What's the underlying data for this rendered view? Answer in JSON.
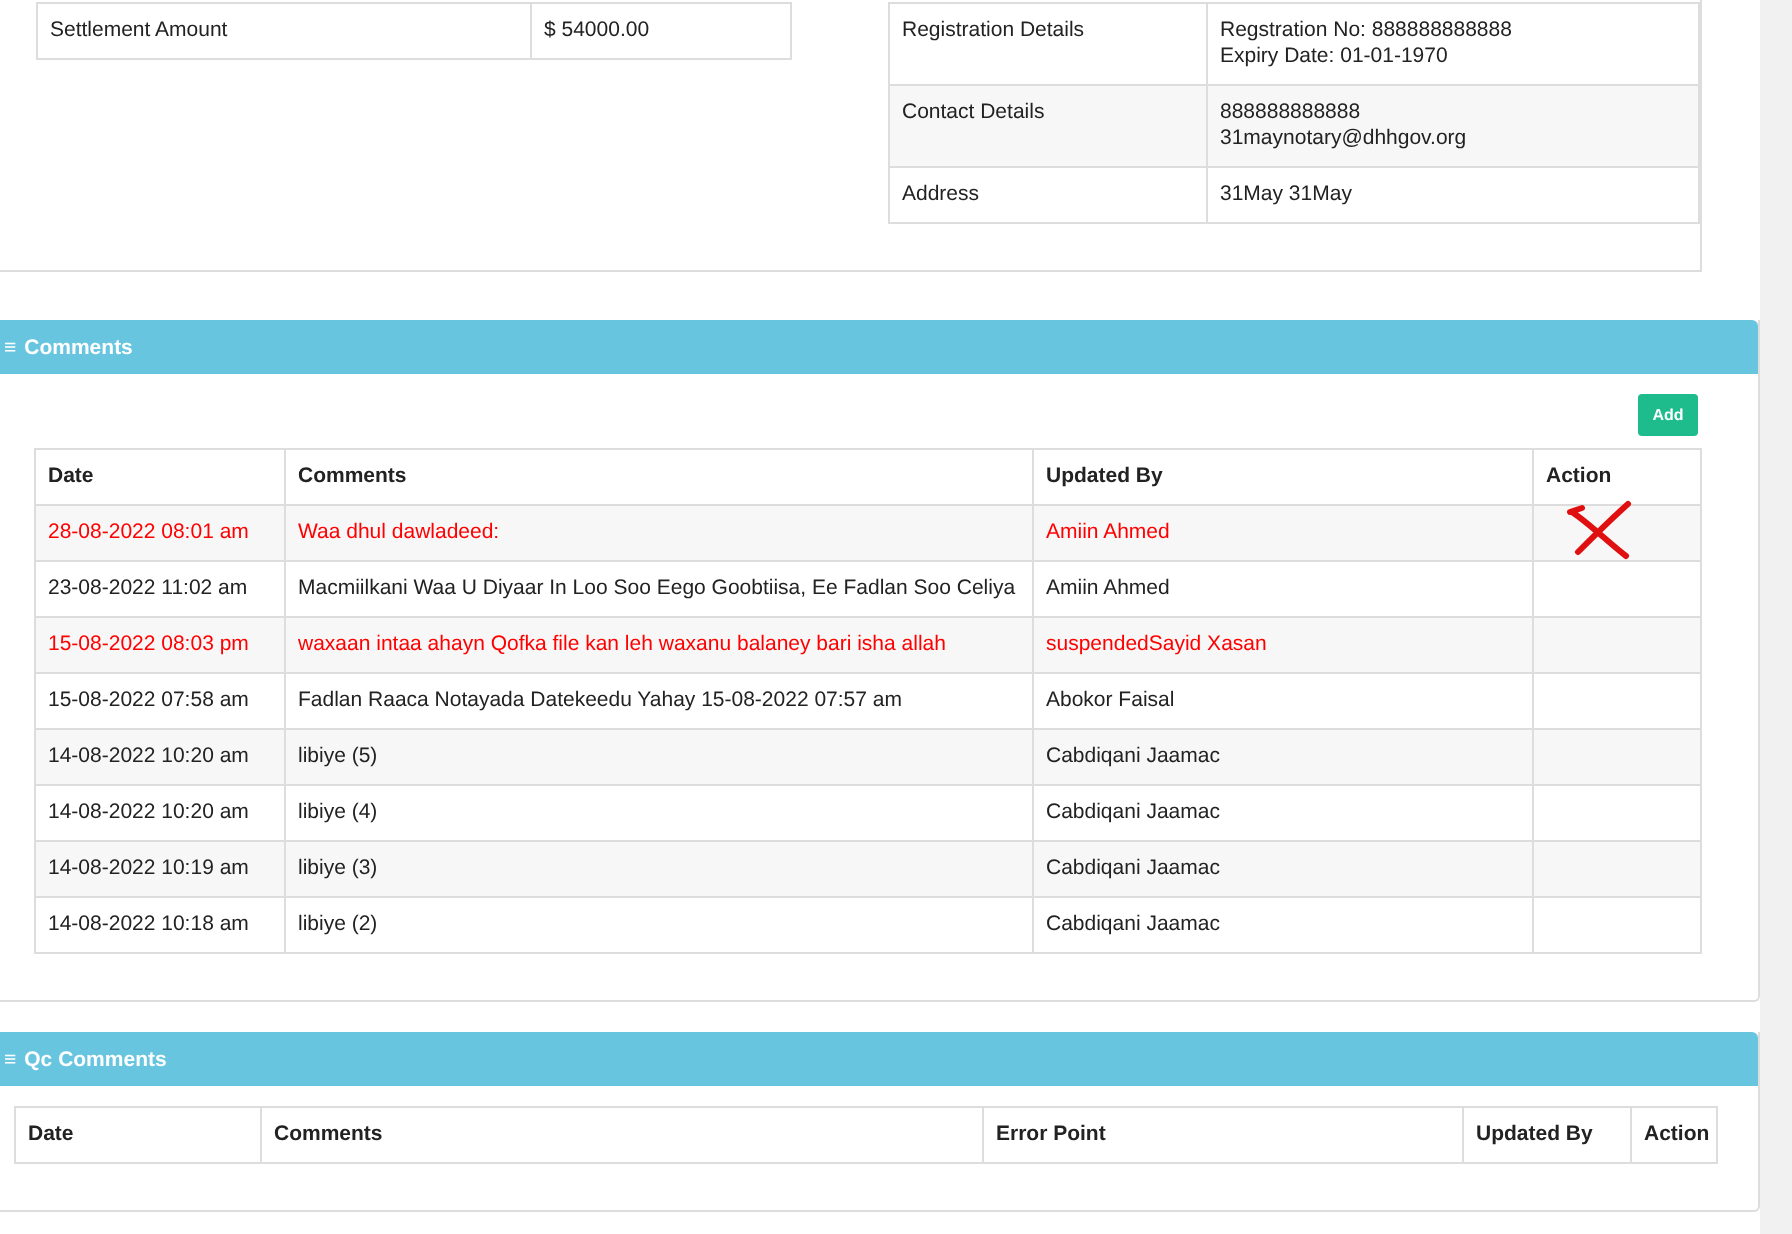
{
  "details_left": [
    {
      "label": "Settlement Amount",
      "value": "$ 54000.00"
    }
  ],
  "details_right": [
    {
      "label": "Registration Details",
      "lines": [
        "Regstration No: 888888888888",
        "Expiry Date: 01-01-1970"
      ]
    },
    {
      "label": "Contact Details",
      "lines": [
        "888888888888",
        "31maynotary@dhhgov.org"
      ]
    },
    {
      "label": "Address",
      "lines": [
        "31May 31May"
      ]
    }
  ],
  "comments": {
    "icon": "≡",
    "title": "Comments",
    "add_button": "Add",
    "columns": [
      "Date",
      "Comments",
      "Updated By",
      "Action"
    ],
    "rows": [
      {
        "date": "28-08-2022 08:01 am",
        "comment": "Waa dhul dawladeed:",
        "updated_by": "Amiin Ahmed",
        "highlighted": true,
        "crossed": true
      },
      {
        "date": "23-08-2022 11:02 am",
        "comment": "Macmiilkani Waa U Diyaar In Loo Soo Eego Goobtiisa, Ee Fadlan Soo Celiya",
        "updated_by": "Amiin Ahmed",
        "highlighted": false,
        "crossed": false
      },
      {
        "date": "15-08-2022 08:03 pm",
        "comment": "waxaan intaa ahayn Qofka file kan leh waxanu balaney bari isha allah",
        "updated_by": "suspendedSayid Xasan",
        "highlighted": true,
        "crossed": false
      },
      {
        "date": "15-08-2022 07:58 am",
        "comment": "Fadlan Raaca Notayada Datekeedu Yahay 15-08-2022 07:57 am",
        "updated_by": "Abokor Faisal",
        "highlighted": false,
        "crossed": false
      },
      {
        "date": "14-08-2022 10:20 am",
        "comment": "libiye (5)",
        "updated_by": "Cabdiqani Jaamac",
        "highlighted": false,
        "crossed": false
      },
      {
        "date": "14-08-2022 10:20 am",
        "comment": "libiye (4)",
        "updated_by": "Cabdiqani Jaamac",
        "highlighted": false,
        "crossed": false
      },
      {
        "date": "14-08-2022 10:19 am",
        "comment": "libiye (3)",
        "updated_by": "Cabdiqani Jaamac",
        "highlighted": false,
        "crossed": false
      },
      {
        "date": "14-08-2022 10:18 am",
        "comment": "libiye (2)",
        "updated_by": "Cabdiqani Jaamac",
        "highlighted": false,
        "crossed": false
      }
    ]
  },
  "qc_comments": {
    "icon": "≡",
    "title": "Qc Comments",
    "columns": [
      "Date",
      "Comments",
      "Error Point",
      "Updated By",
      "Action"
    ]
  }
}
